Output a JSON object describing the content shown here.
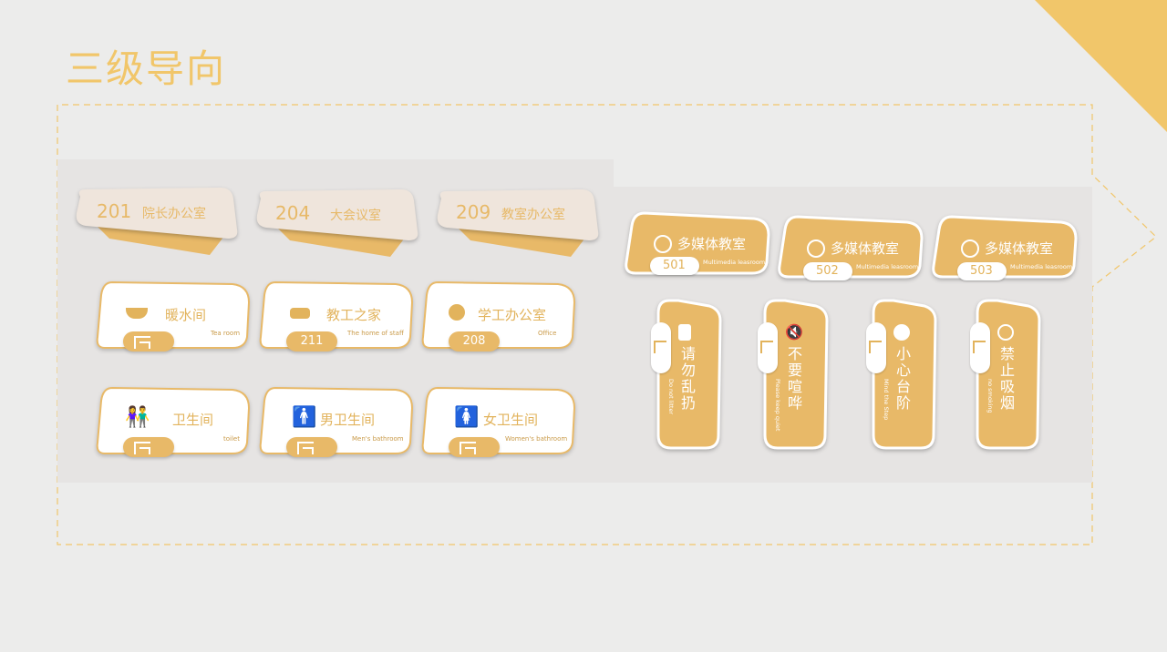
{
  "slide": {
    "title": "三级导向",
    "accent": "#f1c66a"
  },
  "door_plates": [
    {
      "number": "201",
      "name": "院长办公室"
    },
    {
      "number": "204",
      "name": "大会议室"
    },
    {
      "number": "209",
      "name": "教室办公室"
    }
  ],
  "facility_signs": [
    {
      "name": "暖水间",
      "english": "Tea room",
      "tab": "",
      "icon": "teacup-icon"
    },
    {
      "name": "教工之家",
      "english": "The home of staff",
      "tab": "211",
      "icon": "sofa-icon"
    },
    {
      "name": "学工办公室",
      "english": "Office",
      "tab": "208",
      "icon": "lamp-icon"
    },
    {
      "name": "卫生间",
      "english": "toilet",
      "tab": "",
      "icon": "restroom-icon"
    },
    {
      "name": "男卫生间",
      "english": "Men's bathroom",
      "tab": "",
      "icon": "man-icon"
    },
    {
      "name": "女卫生间",
      "english": "Women's bathroom",
      "tab": "",
      "icon": "woman-icon"
    }
  ],
  "media_signs": [
    {
      "name": "多媒体教室",
      "english": "Multimedia leasroom",
      "number": "501"
    },
    {
      "name": "多媒体教室",
      "english": "Multimedia leasroom",
      "number": "502"
    },
    {
      "name": "多媒体教室",
      "english": "Multimedia leasroom",
      "number": "503"
    }
  ],
  "notice_signs": [
    {
      "text": "请勿乱扔",
      "english": "Do not litter",
      "icon": "trash-icon"
    },
    {
      "text": "不要喧哗",
      "english": "Please keep quiet",
      "icon": "mute-icon"
    },
    {
      "text": "小心台阶",
      "english": "Mind the Step",
      "icon": "caution-icon"
    },
    {
      "text": "禁止吸烟",
      "english": "no smoking",
      "icon": "no-smoking-icon"
    }
  ]
}
